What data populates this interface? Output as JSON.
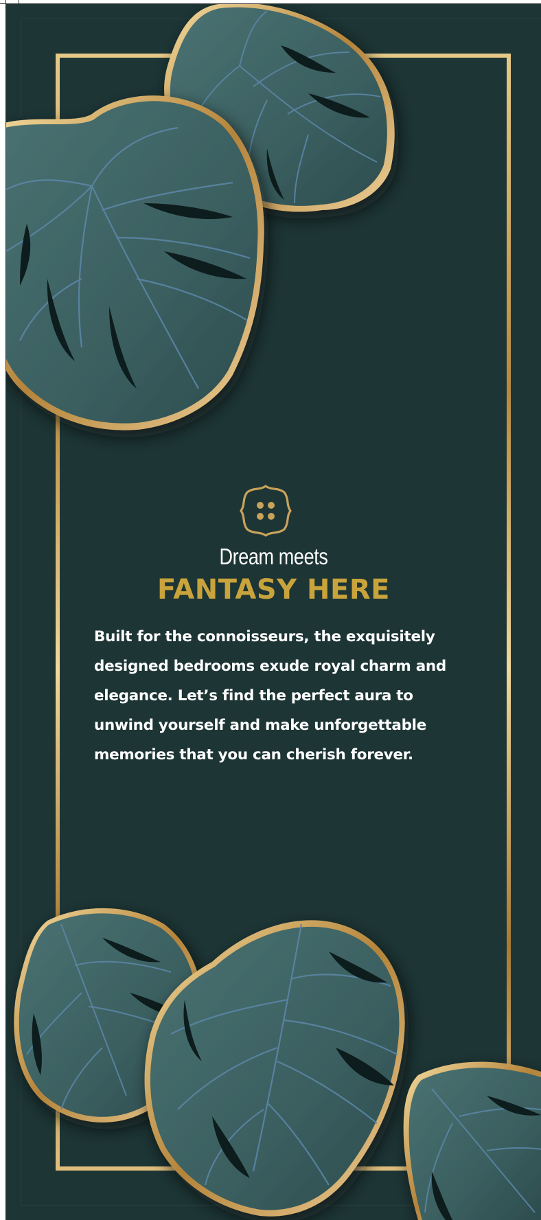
{
  "poster": {
    "subtitle": "Dream meets",
    "title": "FANTASY HERE",
    "body": "Built for the connoisseurs, the exquisitely designed bedrooms exude royal charm and elegance. Let’s find the perfect aura to unwind yourself and make unforgettable memories that you can cherish forever."
  },
  "icons": {
    "logo": "four-dots-badge-icon",
    "decor": "monstera-leaf-icon"
  },
  "colors": {
    "background": "#1d3535",
    "gold": "#c9a33c",
    "leaf": "#3e6262",
    "vein": "#5b86a6",
    "text": "#ffffff"
  }
}
